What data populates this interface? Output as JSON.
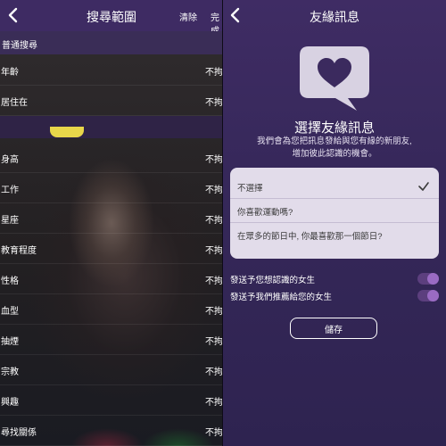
{
  "left": {
    "title": "搜尋範圍",
    "clear_label": "清除",
    "done_label": "完成",
    "section": "普通搜尋",
    "rows": [
      {
        "label": "年齡",
        "value": "不拘"
      },
      {
        "label": "居住在",
        "value": "不拘"
      },
      {
        "label": "身高",
        "value": "不拘"
      },
      {
        "label": "工作",
        "value": "不拘"
      },
      {
        "label": "星座",
        "value": "不拘"
      },
      {
        "label": "教育程度",
        "value": "不拘"
      },
      {
        "label": "性格",
        "value": "不拘"
      },
      {
        "label": "血型",
        "value": "不拘"
      },
      {
        "label": "抽煙",
        "value": "不拘"
      },
      {
        "label": "宗教",
        "value": "不拘"
      },
      {
        "label": "興趣",
        "value": "不拘"
      },
      {
        "label": "尋找關係",
        "value": "不拘"
      }
    ]
  },
  "right": {
    "title": "友緣訊息",
    "headline": "選擇友緣訊息",
    "description_line1": "我們會為您把訊息發給與您有緣的新朋友,",
    "description_line2": "增加彼此認識的機會。",
    "options": [
      {
        "label": "不選擇",
        "selected": true
      },
      {
        "label": "你喜歡運動嗎?",
        "selected": false
      },
      {
        "label": "在眾多的節日中, 你最喜歡那一個節日?",
        "selected": false
      }
    ],
    "toggles": [
      {
        "label": "發送予您想認識的女生",
        "on": true
      },
      {
        "label": "發送予我們推薦給您的女生",
        "on": true
      }
    ],
    "save_label": "儲存"
  },
  "colors": {
    "header_purple": "#3e2b63",
    "panel_purple": "#36285a",
    "toggle_track": "#5c3f7e",
    "toggle_knob": "#9a6bc3",
    "accent_yellow": "#e8d64a"
  },
  "icons": [
    "back-arrow-icon",
    "heart-speech-bubble-icon",
    "checkmark-icon"
  ]
}
